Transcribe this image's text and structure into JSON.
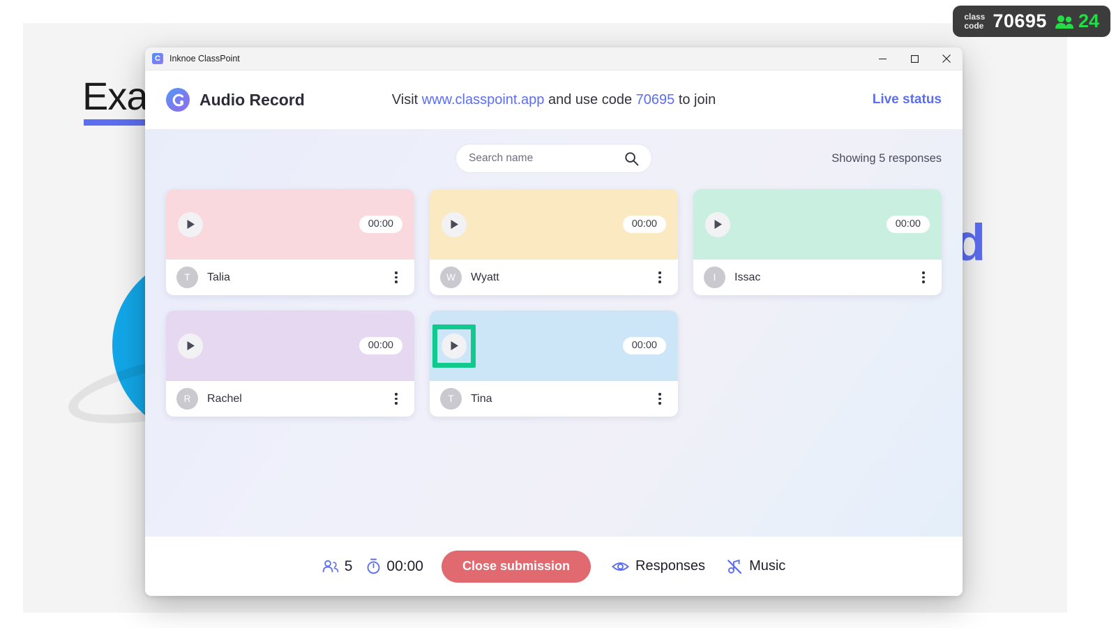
{
  "slide": {
    "title": "Exam",
    "word_right": "d"
  },
  "class_badge": {
    "label": "class\ncode",
    "code": "70695",
    "participants_icon": "people-icon",
    "participants": "24",
    "background": "#3c3c3c",
    "count_color": "#22dd45"
  },
  "window": {
    "app_icon": "classpoint-app-icon",
    "title": "Inknoe ClassPoint",
    "controls": {
      "minimize": "minimize-icon",
      "maximize": "maximize-icon",
      "close": "close-icon"
    }
  },
  "header": {
    "logo": "classpoint-logo",
    "activity_title": "Audio Record",
    "join": {
      "prefix": "Visit ",
      "link": "www.classpoint.app",
      "middle": " and use code ",
      "code": "70695",
      "suffix": " to join"
    },
    "live_status": "Live status",
    "accent": "#5b6ef0"
  },
  "toolbar": {
    "search_placeholder": "Search name",
    "search_value": "",
    "search_icon": "search-icon",
    "showing": "Showing 5 responses"
  },
  "responses": [
    {
      "name": "Talia",
      "initial": "T",
      "duration": "00:00",
      "color": "#f9d8de",
      "play_icon": "play-icon",
      "menu_icon": "kebab-menu-icon",
      "highlighted": false
    },
    {
      "name": "Wyatt",
      "initial": "W",
      "duration": "00:00",
      "color": "#fbe9c2",
      "play_icon": "play-icon",
      "menu_icon": "kebab-menu-icon",
      "highlighted": false
    },
    {
      "name": "Issac",
      "initial": "I",
      "duration": "00:00",
      "color": "#c8efdf",
      "play_icon": "play-icon",
      "menu_icon": "kebab-menu-icon",
      "highlighted": false
    },
    {
      "name": "Rachel",
      "initial": "R",
      "duration": "00:00",
      "color": "#e7d8f2",
      "play_icon": "play-icon",
      "menu_icon": "kebab-menu-icon",
      "highlighted": false
    },
    {
      "name": "Tina",
      "initial": "T",
      "duration": "00:00",
      "color": "#cde6f7",
      "play_icon": "play-icon",
      "menu_icon": "kebab-menu-icon",
      "highlighted": true
    }
  ],
  "highlight": {
    "color": "#10c98c",
    "target": "play-button-tina"
  },
  "footer": {
    "participants_icon": "people-icon",
    "participants_count": "5",
    "timer_icon": "stopwatch-icon",
    "timer": "00:00",
    "close_submission": "Close submission",
    "close_submission_color": "#e06a6f",
    "responses_icon": "eye-icon",
    "responses_label": "Responses",
    "music_icon": "music-off-icon",
    "music_label": "Music"
  }
}
